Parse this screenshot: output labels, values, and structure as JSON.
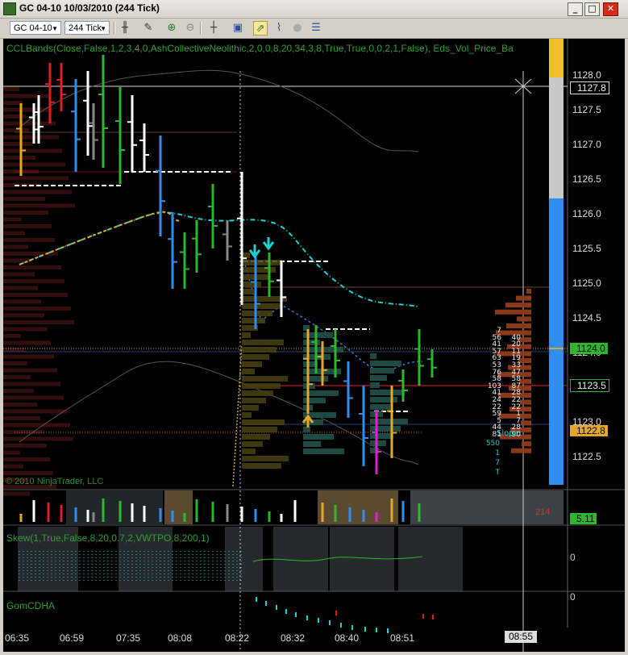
{
  "window": {
    "title": "GC 04-10  10/03/2010 (244 Tick)",
    "btn_minimize": "_",
    "btn_maximize": "□",
    "btn_close": "✕"
  },
  "toolbar": {
    "instrument": "GC 04-10",
    "interval": "244 Tick",
    "tools": [
      "bar-style-icon",
      "pencil-icon",
      "zoom-in-icon",
      "zoom-out-icon",
      "crosshair-icon",
      "properties-icon",
      "strategies-icon",
      "indicators-icon",
      "globe-icon",
      "data-box-icon"
    ]
  },
  "indicators": {
    "main": "CCLBands(Close,False,1,2,3,4,0,AshCollectiveNeolithic,2,0,0,8,20,34,3,8,True,True,0,0,2,1,False), Eds_Vol_Price_Ba",
    "skew": "Skew(1,True,False,8,20,0.7,2,VWTPO,8,200,1)",
    "gomcdha": "GomCDHA",
    "volume_readout": "214",
    "volume_badge": "5.11"
  },
  "copyright": "© 2010 NinjaTrader, LLC",
  "price_axis": {
    "ticks": [
      "1128.0",
      "1127.5",
      "1127.0",
      "1126.5",
      "1126.0",
      "1125.5",
      "1125.0",
      "1124.5",
      "1124.0",
      "1123.5",
      "1123.0",
      "1122.5"
    ],
    "cursor_price": "1127.8",
    "last_price": "1124.0",
    "band_price": "1123.5",
    "low_price": "1122.8"
  },
  "panel_axis": {
    "skew_zero": "0",
    "gom_zero": "0"
  },
  "time_axis": {
    "labels": [
      "06:35",
      "06:59",
      "07:35",
      "08:08",
      "08:22",
      "08:32",
      "08:40",
      "08:51"
    ],
    "cursor_time": "08:55"
  },
  "ladder": {
    "left": [
      "7",
      "56",
      "41",
      "57",
      "63",
      "53",
      "76",
      "58",
      "103",
      "41",
      "24",
      "22",
      "59",
      "5",
      "44",
      "81"
    ],
    "right": [
      "",
      "40",
      "20",
      "11",
      "19",
      "33",
      "47",
      "58",
      "87",
      "28",
      "22",
      "22",
      "1",
      "7",
      "28",
      "90"
    ],
    "slope_label": "Slope:",
    "slope_rows": [
      "550",
      "1",
      "7",
      "T"
    ]
  },
  "colors": {
    "background": "#000000",
    "up_bar": "#2fb52f",
    "down_bar": "#2f8ff0",
    "text_green": "#2fa02f",
    "band_cyan": "#19d3d3",
    "band_gold": "#e3a82a",
    "accent_yellow_badge": "#f0c030"
  }
}
